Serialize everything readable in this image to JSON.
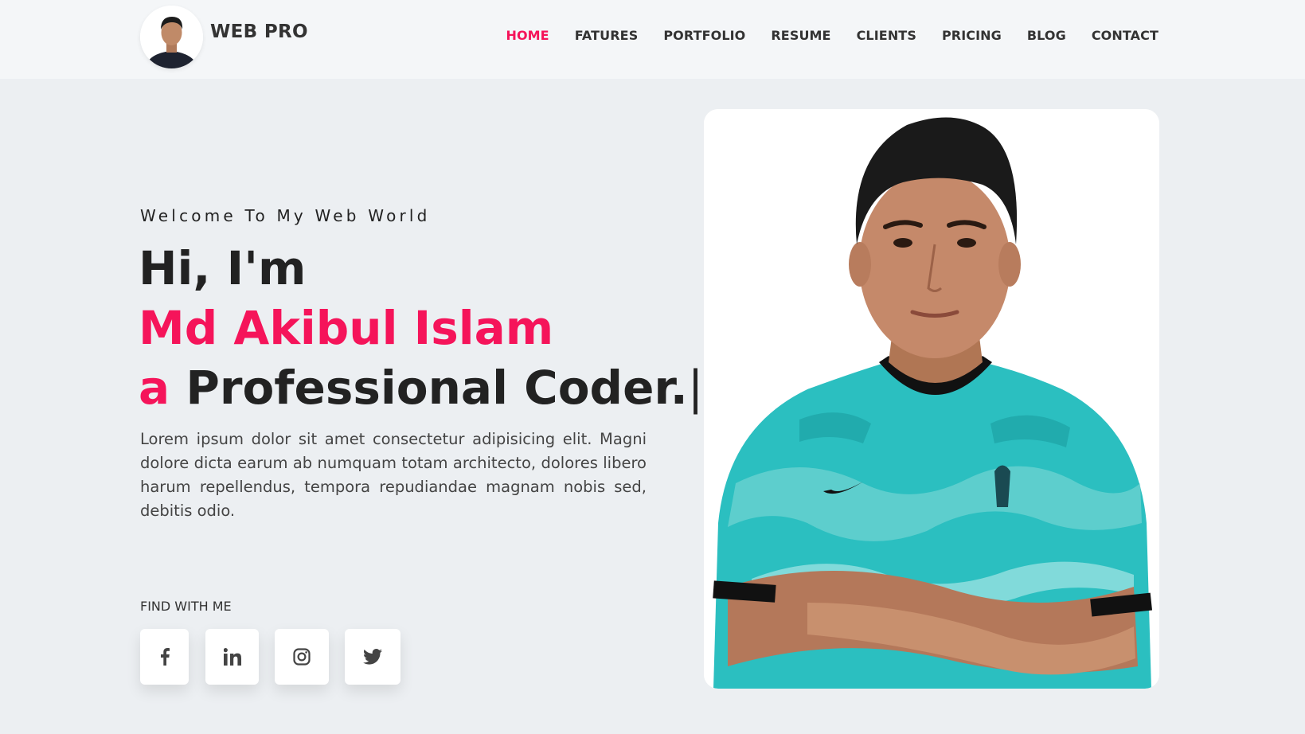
{
  "header": {
    "brand": "WEB PRO",
    "nav": [
      {
        "label": "HOME",
        "active": true
      },
      {
        "label": "FATURES",
        "active": false
      },
      {
        "label": "PORTFOLIO",
        "active": false
      },
      {
        "label": "RESUME",
        "active": false
      },
      {
        "label": "CLIENTS",
        "active": false
      },
      {
        "label": "PRICING",
        "active": false
      },
      {
        "label": "BLOG",
        "active": false
      },
      {
        "label": "CONTACT",
        "active": false
      }
    ]
  },
  "hero": {
    "welcome": "Welcome To My Web World",
    "greeting": "Hi, I'm",
    "name": "Md Akibul Islam",
    "prefix": "a",
    "role": "Professional Coder.",
    "cursor": "|",
    "description": "Lorem ipsum dolor sit amet consectetur adipisicing elit. Magni dolore dicta earum ab numquam totam architecto, dolores libero harum repellendus, tempora repudiandae magnam nobis sed, debitis odio.",
    "find_label": "FIND WITH ME",
    "socials": [
      "facebook-icon",
      "linkedin-icon",
      "instagram-icon",
      "twitter-icon"
    ]
  },
  "colors": {
    "accent": "#f5145a",
    "background": "#eceff2",
    "header_bg": "#f4f6f8",
    "jersey": "#2bbfc0"
  }
}
